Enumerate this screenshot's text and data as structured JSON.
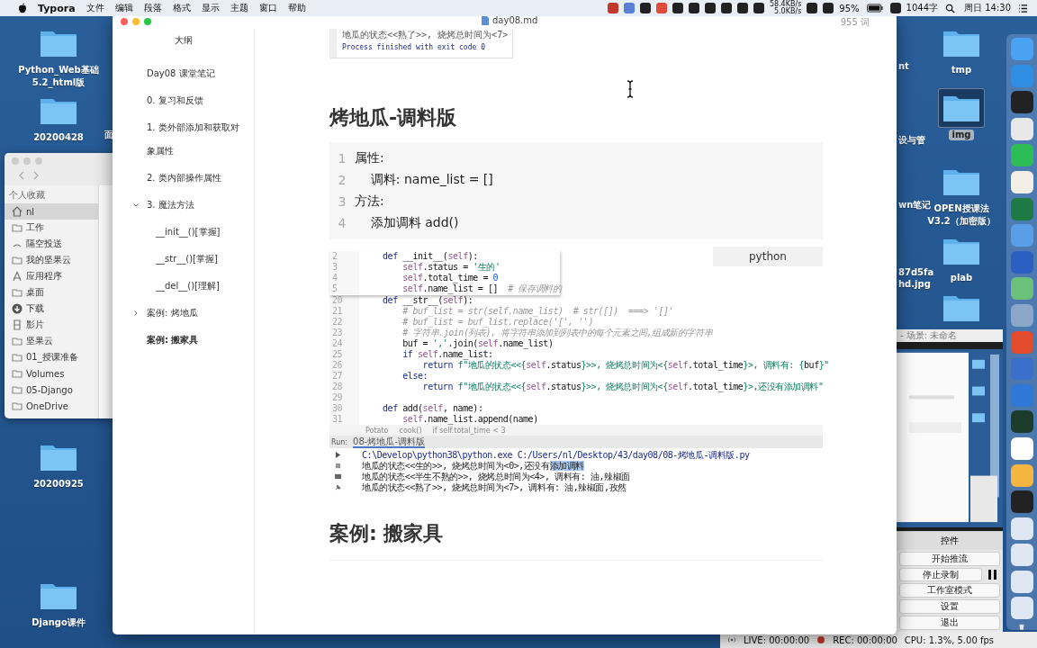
{
  "menu_bar": {
    "app": "Typora",
    "menus": [
      "文件",
      "编辑",
      "段落",
      "格式",
      "显示",
      "主题",
      "窗口",
      "帮助"
    ],
    "net_up": "58.4KB/s",
    "net_down": "5.0KB/s",
    "battery": "95%",
    "word_count": "1044字",
    "clock": "周日 14:30"
  },
  "desktop_left": [
    {
      "lines": [
        "Python_Web基础",
        "5.2_html版"
      ],
      "selected": false
    },
    {
      "lines": [
        "20200428"
      ],
      "selected": false
    },
    {
      "lines": [
        "20200925"
      ],
      "selected": false
    },
    {
      "lines": [
        "Django课件"
      ],
      "selected": false
    }
  ],
  "desktop_right": [
    {
      "lines": [
        "tmp"
      ],
      "selected": false
    },
    {
      "lines": [
        "img"
      ],
      "selected": true
    },
    {
      "lines": [
        "OPEN授课法",
        "V3.2（加密版）"
      ],
      "selected": false
    },
    {
      "lines": [
        "plab"
      ],
      "selected": false
    },
    {
      "selected": false
    }
  ],
  "desktop_cut_labels": [
    "面",
    "nt",
    "设与管",
    "wn笔记",
    "87d5fa",
    "hd.jpg"
  ],
  "finder": {
    "heading": "个人收藏",
    "items": [
      {
        "label": "nl",
        "selected": true
      },
      {
        "label": "工作",
        "selected": false
      },
      {
        "label": "隔空投送",
        "selected": false
      },
      {
        "label": "我的坚果云",
        "selected": false
      },
      {
        "label": "应用程序",
        "selected": false
      },
      {
        "label": "桌面",
        "selected": false
      },
      {
        "label": "下载",
        "selected": false
      },
      {
        "label": "影片",
        "selected": false
      },
      {
        "label": "坚果云",
        "selected": false
      },
      {
        "label": "01_授课准备",
        "selected": false
      },
      {
        "label": "Volumes",
        "selected": false
      },
      {
        "label": "05-Django",
        "selected": false
      },
      {
        "label": "OneDrive",
        "selected": false
      }
    ]
  },
  "typora": {
    "title": "day08.md",
    "word_count": "955 词",
    "outline_title": "大纲",
    "outline": [
      {
        "label": "Day08 课堂笔记",
        "selected": false
      },
      {
        "label": "0. 复习和反馈",
        "selected": false
      },
      {
        "label": "1. 类外部添加和获取对象属性",
        "selected": false
      },
      {
        "label": "2. 类内部操作属性",
        "selected": false
      },
      {
        "label": "3. 魔法方法",
        "selected": false,
        "expanded": true,
        "children": [
          {
            "label": "__init__()[掌握]",
            "selected": false
          },
          {
            "label": "__str__()[掌握]",
            "selected": false
          },
          {
            "label": "__del__()[理解]",
            "selected": false
          }
        ]
      },
      {
        "label": "案例: 烤地瓜",
        "selected": false,
        "expanded": false
      },
      {
        "label": "案例: 搬家具",
        "selected": true
      }
    ],
    "document": {
      "output_image": {
        "lines": [
          {
            "kind": "plain",
            "text": "地瓜的状态<<熟了>>, 烧烤总时间为<7>"
          },
          {
            "kind": "info",
            "text": "Process finished with exit code 0"
          }
        ]
      },
      "heading_1": "烤地瓜-调料版",
      "code_block": {
        "language": "python",
        "lines": [
          {
            "n": "1",
            "text": "属性:"
          },
          {
            "n": "2",
            "text": "    调料: name_list = []"
          },
          {
            "n": "3",
            "text": "方法:"
          },
          {
            "n": "4",
            "text": "    添加调料 add()"
          }
        ]
      },
      "ide_image": {
        "popup_lines": [
          {
            "n": "2",
            "tokens": [
              {
                "kind": "keyword",
                "text": "def "
              },
              {
                "kind": "plain",
                "text": "__init__("
              },
              {
                "kind": "self",
                "text": "self"
              },
              {
                "kind": "plain",
                "text": "):"
              }
            ]
          },
          {
            "n": "3",
            "tokens": [
              {
                "kind": "self",
                "text": "    self"
              },
              {
                "kind": "plain",
                "text": ".status = "
              },
              {
                "kind": "string",
                "text": "'生的'"
              }
            ]
          },
          {
            "n": "4",
            "tokens": [
              {
                "kind": "self",
                "text": "    self"
              },
              {
                "kind": "plain",
                "text": ".total_time = "
              },
              {
                "kind": "number",
                "text": "0"
              }
            ]
          },
          {
            "n": "5",
            "tokens": [
              {
                "kind": "self",
                "text": "    self"
              },
              {
                "kind": "plain",
                "text": ".name_list = []  "
              },
              {
                "kind": "comment",
                "text": "# 保存调料的"
              }
            ]
          }
        ],
        "code_lines": [
          {
            "n": "20",
            "tokens": [
              {
                "kind": "keyword",
                "text": "def "
              },
              {
                "kind": "plain",
                "text": "__str__("
              },
              {
                "kind": "self",
                "text": "self"
              },
              {
                "kind": "plain",
                "text": "):"
              }
            ]
          },
          {
            "n": "21",
            "tokens": [
              {
                "kind": "comment",
                "text": "    # buf_list = str(self.name_list)  # str([])  ===> '[]'"
              }
            ]
          },
          {
            "n": "22",
            "tokens": [
              {
                "kind": "comment",
                "text": "    # buf_list = buf_list.replace('[', '')"
              }
            ]
          },
          {
            "n": "23",
            "tokens": [
              {
                "kind": "comment",
                "text": "    # 字符串.join(列表), 将字符串添加到列表中的每个元素之间,组成新的字符串"
              }
            ]
          },
          {
            "n": "24",
            "tokens": [
              {
                "kind": "plain",
                "text": "    buf = "
              },
              {
                "kind": "string",
                "text": "','"
              },
              {
                "kind": "plain",
                "text": ".join("
              },
              {
                "kind": "self",
                "text": "self"
              },
              {
                "kind": "plain",
                "text": ".name_list)"
              }
            ]
          },
          {
            "n": "25",
            "tokens": [
              {
                "kind": "keyword",
                "text": "    if "
              },
              {
                "kind": "self",
                "text": "self"
              },
              {
                "kind": "plain",
                "text": ".name_list:"
              }
            ]
          },
          {
            "n": "26",
            "tokens": [
              {
                "kind": "keyword",
                "text": "        return "
              },
              {
                "kind": "string",
                "text": "f\"地瓜的状态<<{"
              },
              {
                "kind": "self",
                "text": "self"
              },
              {
                "kind": "plain",
                "text": ".status"
              },
              {
                "kind": "string",
                "text": "}>>, 烧烤总时间为<{"
              },
              {
                "kind": "self",
                "text": "self"
              },
              {
                "kind": "plain",
                "text": ".total_time"
              },
              {
                "kind": "string",
                "text": "}>, 调料有: {"
              },
              {
                "kind": "plain",
                "text": "buf"
              },
              {
                "kind": "string",
                "text": "}\""
              }
            ]
          },
          {
            "n": "27",
            "tokens": [
              {
                "kind": "keyword",
                "text": "    else:"
              }
            ]
          },
          {
            "n": "28",
            "tokens": [
              {
                "kind": "keyword",
                "text": "        return "
              },
              {
                "kind": "string",
                "text": "f\"地瓜的状态<<{"
              },
              {
                "kind": "self",
                "text": "self"
              },
              {
                "kind": "plain",
                "text": ".status"
              },
              {
                "kind": "string",
                "text": "}>>, 烧烤总时间为<{"
              },
              {
                "kind": "self",
                "text": "self"
              },
              {
                "kind": "plain",
                "text": ".total_time"
              },
              {
                "kind": "string",
                "text": "}>,还没有添加调料\""
              }
            ]
          },
          {
            "n": "29"
          },
          {
            "n": "30",
            "tokens": [
              {
                "kind": "keyword",
                "text": "def "
              },
              {
                "kind": "plain",
                "text": "add("
              },
              {
                "kind": "self",
                "text": "self"
              },
              {
                "kind": "plain",
                "text": ", name):"
              }
            ]
          },
          {
            "n": "31",
            "tokens": [
              {
                "kind": "self",
                "text": "    self"
              },
              {
                "kind": "plain",
                "text": ".name_list.append(name)"
              }
            ]
          }
        ],
        "breadcrumbs": [
          "Potato",
          "cook()",
          "if self.total_time < 3"
        ],
        "run_label": "Run:",
        "run_tab": "08-烤地瓜-调料版",
        "console_lines": [
          {
            "kind": "command",
            "text": "C:\\Develop\\python38\\python.exe C:/Users/nl/Desktop/43/day08/08-烤地瓜-调料版.py"
          },
          {
            "kind": "output",
            "text": "地瓜的状态<<生的>>, 烧烤总时间为<0>,还没有",
            "selection": "添加调料"
          },
          {
            "kind": "output",
            "text": "地瓜的状态<<半生不熟的>>, 烧烤总时间为<4>, 调料有: 油,辣椒面"
          },
          {
            "kind": "output",
            "text": "地瓜的状态<<熟了>>, 烧烤总时间为<7>, 调料有: 油,辣椒面,孜然"
          }
        ]
      },
      "heading_2": "案例: 搬家具"
    }
  },
  "obs": {
    "title": "- 场景: 未命名",
    "panel_title": "控件",
    "buttons": [
      {
        "label": "开始推流"
      },
      {
        "label": "停止录制"
      },
      {
        "label": "工作室模式"
      },
      {
        "label": "设置"
      },
      {
        "label": "退出"
      }
    ],
    "live": "LIVE: 00:00:00",
    "rec": "REC: 00:00:00",
    "cpu": "CPU: 1.3%, 5.00 fps"
  }
}
